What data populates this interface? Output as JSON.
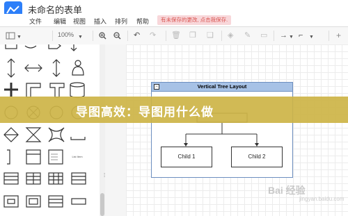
{
  "app": {
    "title": "未命名的表单",
    "unsaved_notice": "有未保存的更改, 点击我保存."
  },
  "menu": [
    "文件",
    "编辑",
    "视图",
    "插入",
    "排列",
    "帮助"
  ],
  "toolbar": {
    "zoom": "100%",
    "add_label": "+"
  },
  "diagram": {
    "container_title": "Vertical Tree Layout",
    "children": [
      "Child 1",
      "Child 2"
    ]
  },
  "sidebar": {
    "list_item_label": "List Item"
  },
  "banner": {
    "text": "导图高效：导图用什么做"
  },
  "watermark": {
    "text": "Bai 经验",
    "sub": "jingyan.baidu.com"
  }
}
